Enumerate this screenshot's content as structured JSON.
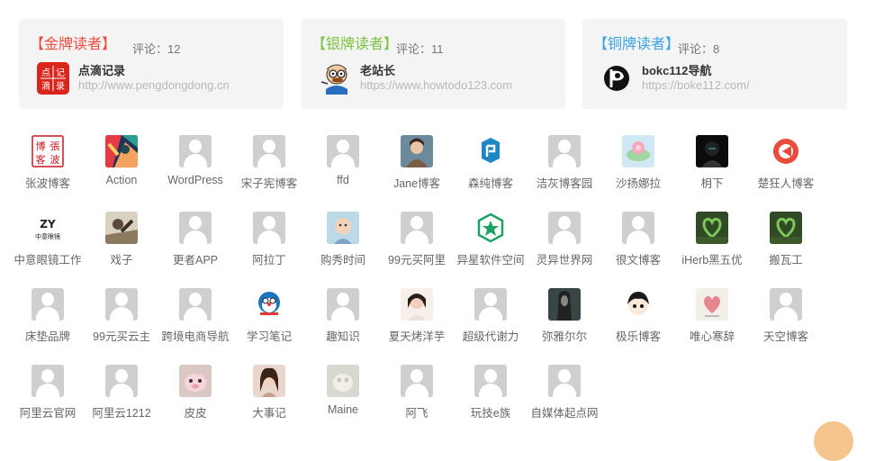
{
  "medals": [
    {
      "rank": "【金牌读者】",
      "count": "评论：12",
      "name": "点滴记录",
      "url": "http://www.pengdongdong.cn",
      "color": "#e94b3c",
      "avatar": "dianji"
    },
    {
      "rank": "【银牌读者】",
      "count": "评论：11",
      "name": "老站长",
      "url": "https://www.howtodo123.com",
      "color": "#7dc242",
      "avatar": "laozhan"
    },
    {
      "rank": "【铜牌读者】",
      "count": "评论：8",
      "name": "bokc112导航",
      "url": "https://boke112.com/",
      "color": "#3ba3e0",
      "avatar": "bokc"
    }
  ],
  "dianji_chars": [
    "点",
    "记",
    "滴",
    "录"
  ],
  "readers": [
    {
      "name": "张波博客",
      "avatar": "zhangbo",
      "stamp": "博張客波"
    },
    {
      "name": "Action",
      "avatar": "action"
    },
    {
      "name": "WordPress",
      "avatar": "default"
    },
    {
      "name": "宋子宪博客",
      "avatar": "default"
    },
    {
      "name": "ffd",
      "avatar": "default"
    },
    {
      "name": "Jane博客",
      "avatar": "jane"
    },
    {
      "name": "森纯博客",
      "avatar": "senchun"
    },
    {
      "name": "洁灰博客园",
      "avatar": "default"
    },
    {
      "name": "沙扬娜拉",
      "avatar": "shayang"
    },
    {
      "name": "枂下",
      "avatar": "yuexia"
    },
    {
      "name": "楚狂人博客",
      "avatar": "chukuang"
    },
    {
      "name": "中意眼镜工作",
      "avatar": "zhongyi",
      "logo": "ZY",
      "sub": "中意眼镜"
    },
    {
      "name": "戏子",
      "avatar": "xizi"
    },
    {
      "name": "更者APP",
      "avatar": "default"
    },
    {
      "name": "阿拉丁",
      "avatar": "default"
    },
    {
      "name": "购秀时间",
      "avatar": "gouxiu"
    },
    {
      "name": "99元买阿里",
      "avatar": "default"
    },
    {
      "name": "异星软件空间",
      "avatar": "yixing"
    },
    {
      "name": "灵异世界网",
      "avatar": "default"
    },
    {
      "name": "很文博客",
      "avatar": "default"
    },
    {
      "name": "iHerb黑五优",
      "avatar": "iherb"
    },
    {
      "name": "搬瓦工",
      "avatar": "iherb"
    },
    {
      "name": "床垫品牌",
      "avatar": "default"
    },
    {
      "name": "99元买云主",
      "avatar": "default"
    },
    {
      "name": "跨境电商导航",
      "avatar": "default"
    },
    {
      "name": "学习笔记",
      "avatar": "xuexi"
    },
    {
      "name": "趣知识",
      "avatar": "default"
    },
    {
      "name": "夏天烤洋芋",
      "avatar": "xiatian"
    },
    {
      "name": "超级代谢力",
      "avatar": "default"
    },
    {
      "name": "弥雅尔尔",
      "avatar": "miya"
    },
    {
      "name": "极乐博客",
      "avatar": "jile"
    },
    {
      "name": "唯心寒辞",
      "avatar": "weixin"
    },
    {
      "name": "天空博客",
      "avatar": "default"
    },
    {
      "name": "阿里云官网",
      "avatar": "default"
    },
    {
      "name": "阿里云1212",
      "avatar": "default"
    },
    {
      "name": "皮皮",
      "avatar": "pipi"
    },
    {
      "name": "大事记",
      "avatar": "dashi"
    },
    {
      "name": "Maine",
      "avatar": "maine"
    },
    {
      "name": "阿飞",
      "avatar": "default"
    },
    {
      "name": "玩技e族",
      "avatar": "default"
    },
    {
      "name": "自媒体起点网",
      "avatar": "default"
    }
  ]
}
